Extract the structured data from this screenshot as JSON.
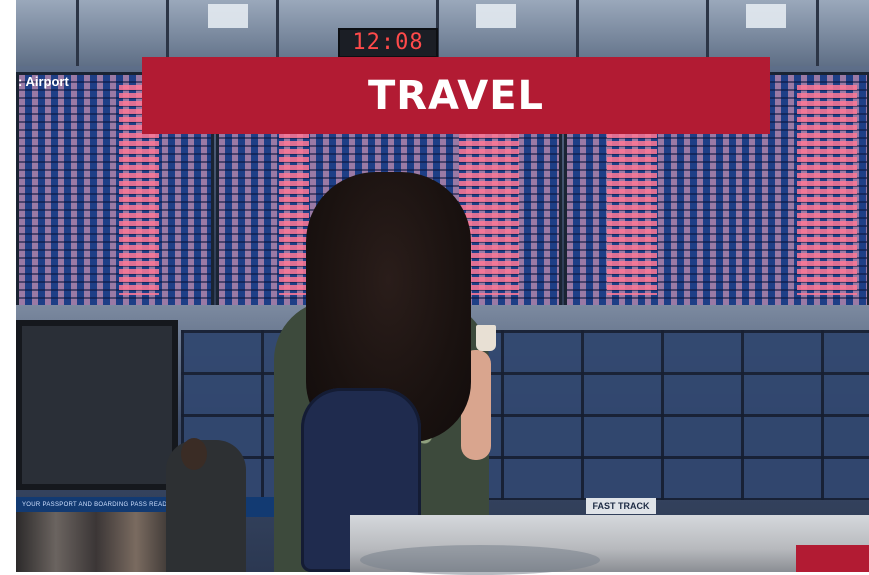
{
  "banner": {
    "title": "TRAVEL"
  },
  "scene": {
    "clock": "12:08",
    "screen_text": ": Airport",
    "sign_text": "YOUR PASSPORT AND BOARDING PASS READY",
    "fast_track": "FAST TRACK"
  },
  "colors": {
    "accent": "#b21b33"
  }
}
